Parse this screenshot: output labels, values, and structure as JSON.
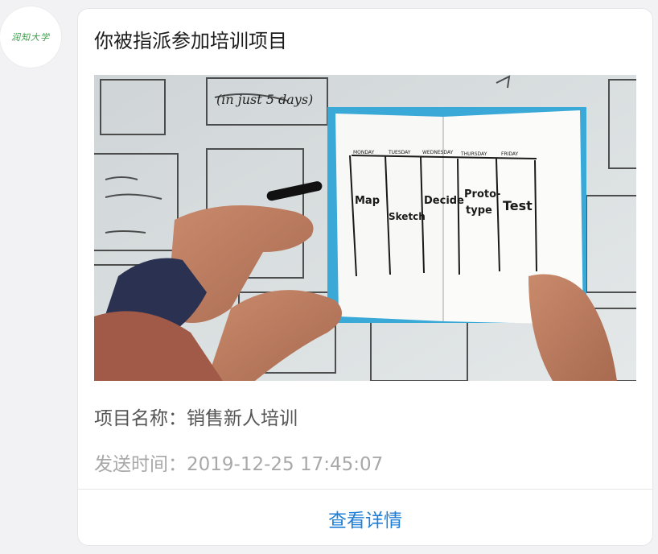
{
  "avatar": {
    "text": "润知大学"
  },
  "card": {
    "title": "你被指派参加培训项目",
    "project_label": "项目名称：",
    "project_name": "销售新人培训",
    "time_label": "发送时间：",
    "time_value": "2019-12-25 17:45:07",
    "detail_button": "查看详情"
  },
  "colors": {
    "accent": "#1f7fd6",
    "background": "#f2f2f4",
    "card": "#ffffff"
  }
}
